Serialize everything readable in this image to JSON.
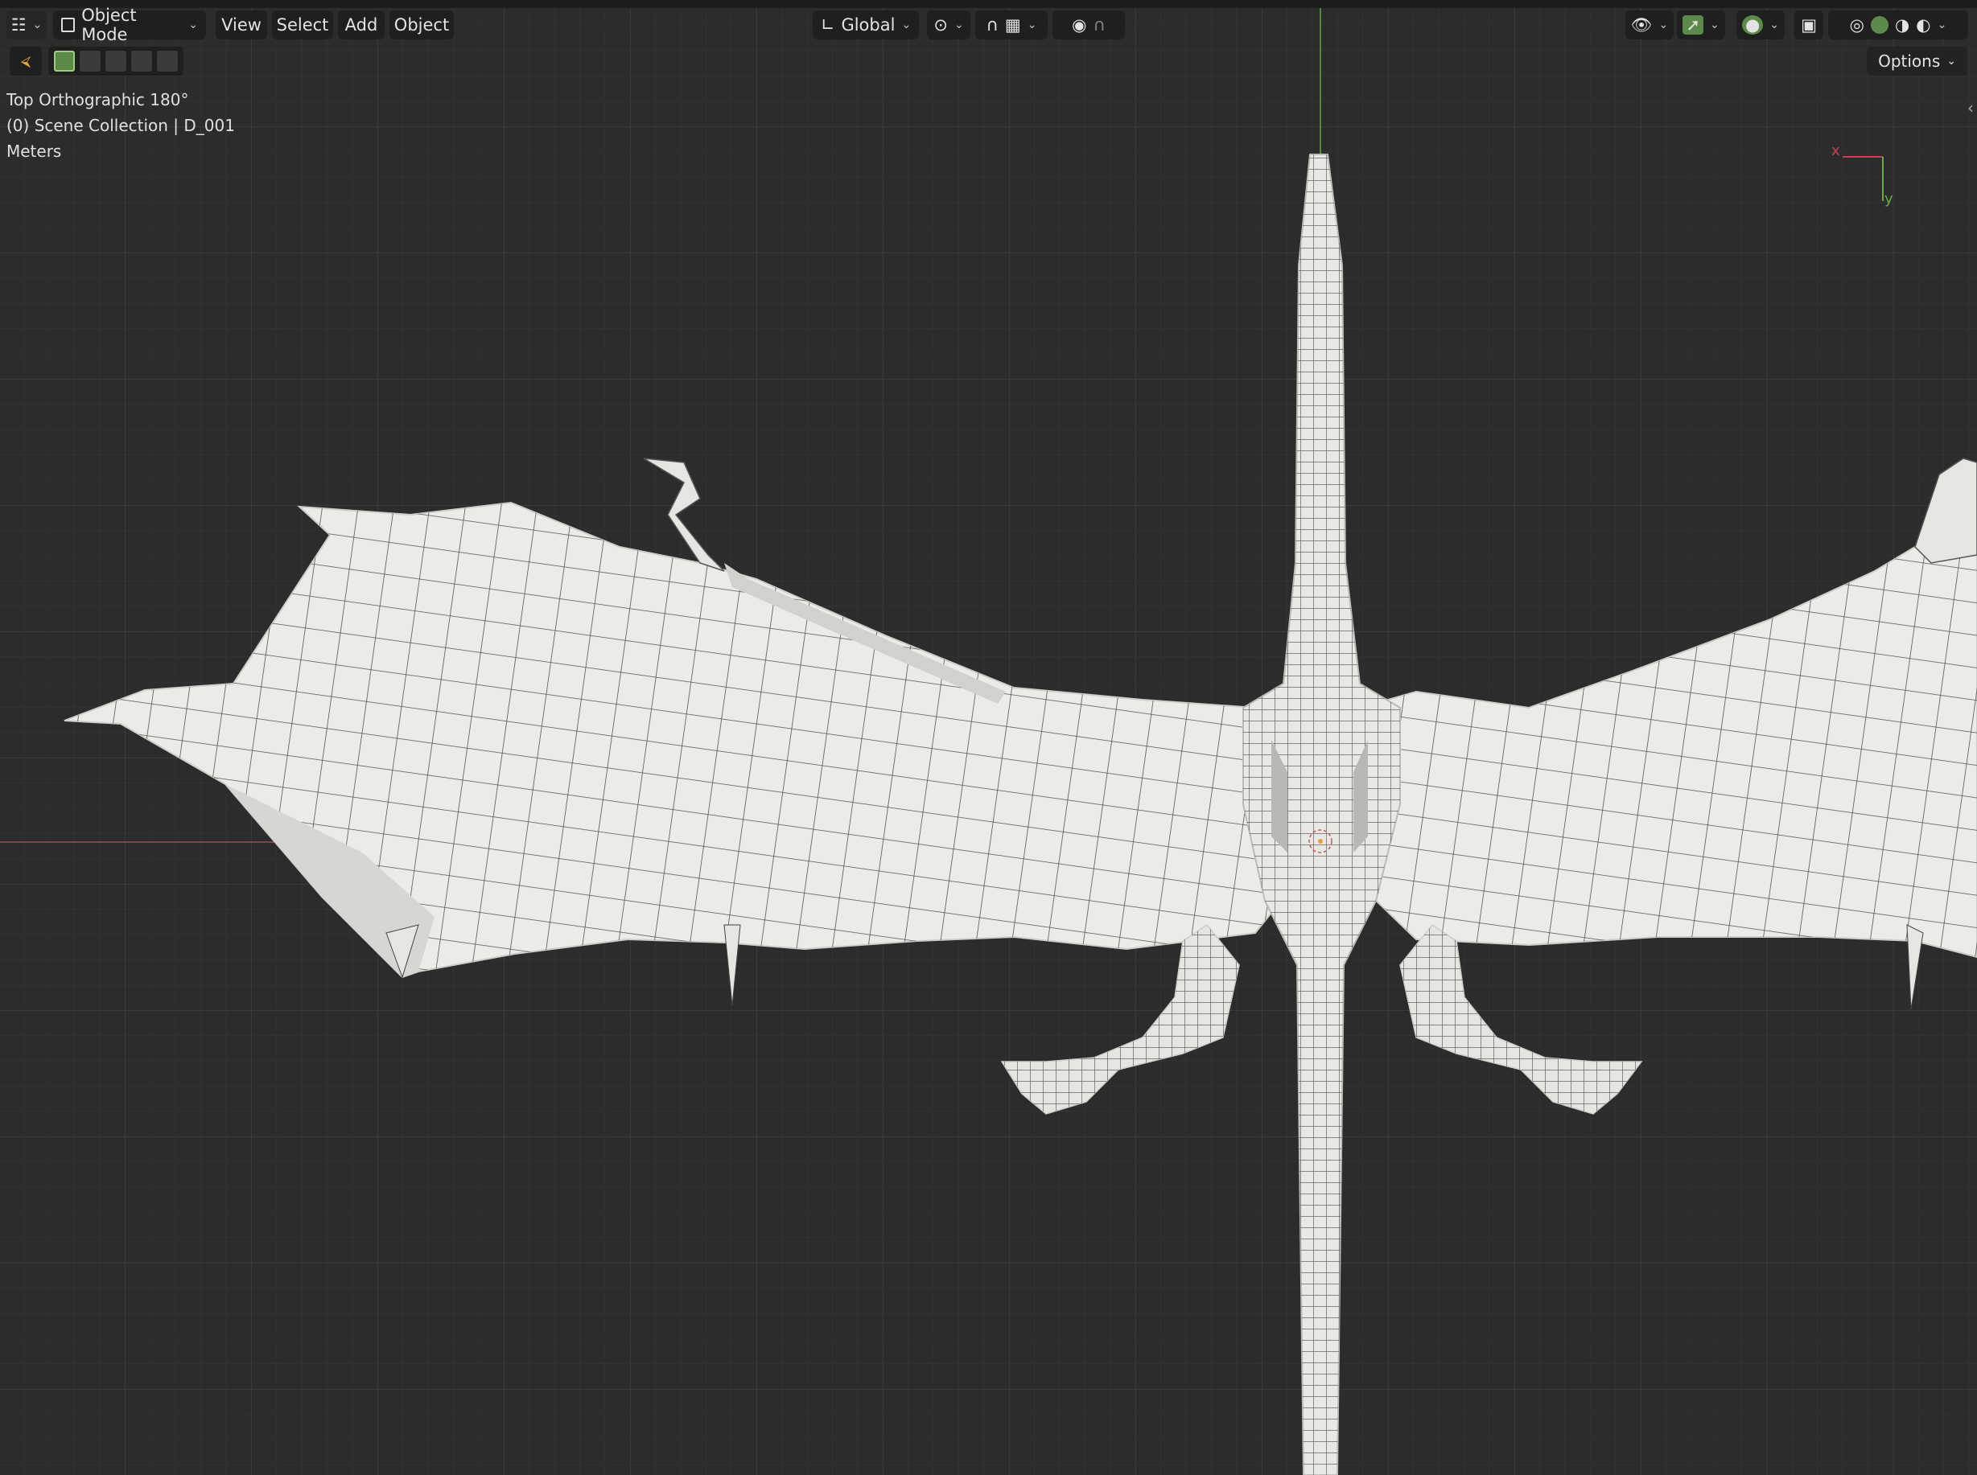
{
  "header": {
    "editor_type_icon": "editor-type-icon",
    "mode": {
      "label": "Object Mode",
      "icon": "object-mode-icon"
    },
    "menus": [
      "View",
      "Select",
      "Add",
      "Object"
    ],
    "transform_orientation": "Global",
    "pivot_icon": "pivot-point-icon",
    "snap_icon": "magnet-icon",
    "snap_grid_icon": "snap-increment-icon",
    "proportional_icon": "proportional-edit-icon",
    "falloff_icon": "falloff-curve-icon",
    "visibility_icon": "eye-icon",
    "gizmo_icon": "gizmo-icon",
    "overlay_icon": "overlays-icon",
    "xray_icon": "xray-icon",
    "shading_icons": [
      "wireframe-shading-icon",
      "solid-shading-icon",
      "material-shading-icon",
      "rendered-shading-icon"
    ]
  },
  "tool_header": {
    "select_tool_icon": "select-box-icon",
    "selection_modes": [
      "set-new-selection-icon",
      "extend-selection-icon",
      "subtract-selection-icon",
      "invert-selection-icon",
      "intersect-selection-icon"
    ],
    "options_label": "Options"
  },
  "viewport": {
    "view_name": "Top Orthographic 180°",
    "collection": "(0) Scene Collection | D_001",
    "units": "Meters",
    "gizmo_x": "x",
    "gizmo_y": "y",
    "colors": {
      "background": "#2c2c2c",
      "mesh": "#ecebe8",
      "wire": "#1e1e1e",
      "x_axis": "#a0475a",
      "y_axis": "#6aa84f",
      "accent_green": "#5c8a4a"
    }
  }
}
